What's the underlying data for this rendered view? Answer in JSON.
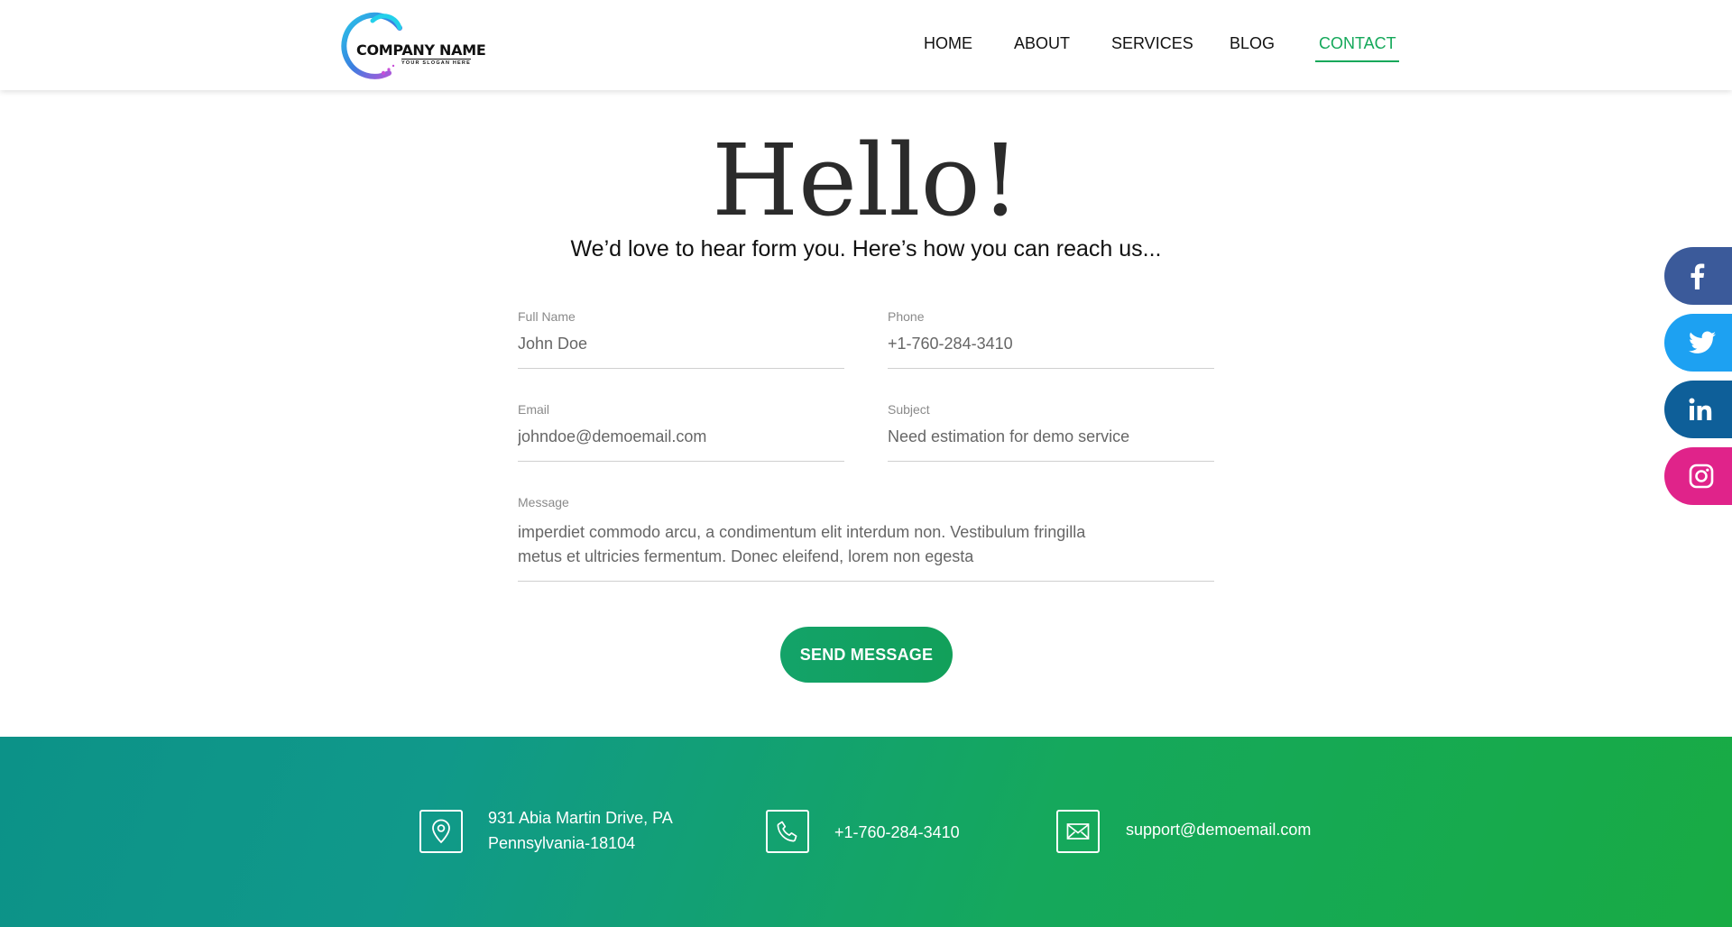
{
  "brand": {
    "name": "COMPANY NAME",
    "slogan": "YOUR SLOGAN HERE",
    "accent": "#14a85a"
  },
  "nav": {
    "items": [
      {
        "label": "HOME"
      },
      {
        "label": "ABOUT"
      },
      {
        "label": "SERVICES"
      },
      {
        "label": "BLOG"
      },
      {
        "label": "CONTACT",
        "active": true
      }
    ]
  },
  "hero": {
    "title": "Hello!",
    "subtitle": "We’d love to hear form you. Here’s how you can reach us..."
  },
  "form": {
    "full_name": {
      "label": "Full Name",
      "value": "John Doe"
    },
    "phone": {
      "label": "Phone",
      "value": "+1-760-284-3410"
    },
    "email": {
      "label": "Email",
      "value": "johndoe@demoemail.com"
    },
    "subject": {
      "label": "Subject",
      "value": "Need estimation for demo service"
    },
    "message": {
      "label": "Message",
      "line1": "imperdiet commodo arcu, a condimentum elit interdum non. Vestibulum fringilla",
      "line2": "metus et ultricies fermentum. Donec eleifend, lorem non egesta"
    },
    "submit_label": "SEND MESSAGE"
  },
  "social": [
    {
      "name": "facebook-icon",
      "color": "#3b5a9a"
    },
    {
      "name": "twitter-icon",
      "color": "#1da1f2"
    },
    {
      "name": "linkedin-icon",
      "color": "#0e5f99"
    },
    {
      "name": "instagram-icon",
      "color": "#e0238a"
    }
  ],
  "footer": {
    "address_line1": "931  Abia Martin Drive, PA",
    "address_line2": "Pennsylvania-18104",
    "phone": "+1-760-284-3410",
    "email": "support@demoemail.com"
  }
}
